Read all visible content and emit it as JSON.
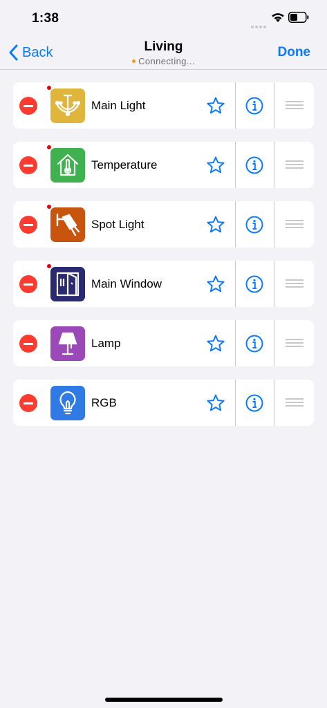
{
  "status_bar": {
    "time": "1:38"
  },
  "nav": {
    "back_label": "Back",
    "title": "Living",
    "subtitle": "Connecting...",
    "done_label": "Done"
  },
  "colors": {
    "accent": "#0a7aff",
    "delete": "#ff3b30",
    "connecting_dot": "#ff9500",
    "unread_dot": "#e8000b"
  },
  "devices": [
    {
      "name": "Main Light",
      "icon": "chandelier-icon",
      "color": "#e0b53b",
      "unread": true
    },
    {
      "name": "Temperature",
      "icon": "thermometer-house-icon",
      "color": "#3fb24f",
      "unread": true
    },
    {
      "name": "Spot Light",
      "icon": "spotlight-icon",
      "color": "#c9540e",
      "unread": true
    },
    {
      "name": "Main Window",
      "icon": "window-icon",
      "color": "#2a2a72",
      "unread": true
    },
    {
      "name": "Lamp",
      "icon": "lamp-icon",
      "color": "#9b48b8",
      "unread": false
    },
    {
      "name": "RGB",
      "icon": "lightbulb-icon",
      "color": "#2f7ae5",
      "unread": false
    }
  ]
}
